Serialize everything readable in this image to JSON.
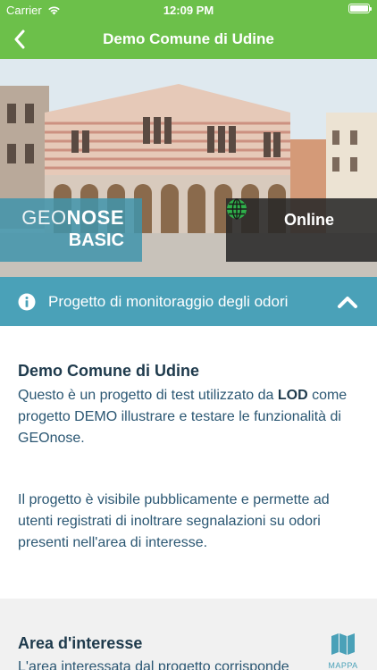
{
  "status_bar": {
    "carrier": "Carrier",
    "time": "12:09 PM"
  },
  "navbar": {
    "title": "Demo Comune di Udine",
    "back_icon": "chevron-left-icon"
  },
  "hero": {
    "brand_light": "GEO",
    "brand_bold": "NOSE",
    "brand_line2": "BASIC",
    "status": "Online",
    "status_icon": "globe-icon"
  },
  "accordion": {
    "label": "Progetto di monitoraggio degli odori",
    "icon": "info-icon",
    "toggle_icon": "chevron-up-icon"
  },
  "project": {
    "title": "Demo Comune di Udine",
    "desc_prefix": "Questo è un progetto di test utilizzato da ",
    "desc_bold": "LOD",
    "desc_suffix": " come progetto DEMO illustrare e testare le funzionalità di GEOnose.",
    "desc2": "Il progetto è visibile pubblicamente e permette ad utenti registrati di inoltrare segnalazioni su odori presenti nell'area di interesse."
  },
  "area": {
    "title": "Area d'interesse",
    "text_cut": "L'area interessata dal progetto corrisponde",
    "map_label": "MAPPA"
  },
  "colors": {
    "accent_green": "#6cc04a",
    "accent_teal": "#4aa1b8",
    "text_dark": "#1e3a4c"
  }
}
